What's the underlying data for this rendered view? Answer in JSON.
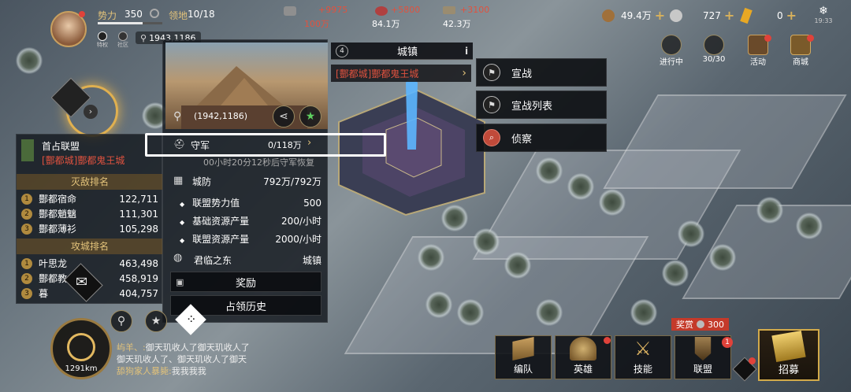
{
  "player": {
    "power_label": "势力",
    "power_value": "350",
    "territory_label": "领地",
    "territory_value": "10/18",
    "coords": "1943,1186",
    "tag_label": "特权",
    "community_label": "社区"
  },
  "production": [
    {
      "delta": "+9975",
      "total": "100万"
    },
    {
      "delta": "+5800",
      "total": "84.1万"
    },
    {
      "delta": "+3100",
      "total": "42.3万"
    }
  ],
  "currency": [
    {
      "value": "49.4万"
    },
    {
      "value": "727"
    },
    {
      "value": "0"
    }
  ],
  "clock": "19:33",
  "top_right_buttons": [
    {
      "label": "进行中"
    },
    {
      "label": "30/30"
    },
    {
      "label": "活动"
    },
    {
      "label": "商城"
    }
  ],
  "alliance_panel": {
    "title": "首占联盟",
    "city": "[酆都城]酆都鬼王城",
    "kill_rank_title": "灭敌排名",
    "kill_rank": [
      {
        "name": "酆都宿命",
        "value": "122,711"
      },
      {
        "name": "酆都魈魑",
        "value": "111,301"
      },
      {
        "name": "酆都薄衫",
        "value": "105,298"
      }
    ],
    "siege_rank_title": "攻城排名",
    "siege_rank": [
      {
        "name": "叶思龙",
        "value": "463,498"
      },
      {
        "name": "酆都教",
        "value": "458,919"
      },
      {
        "name": "暮",
        "value": "404,757"
      }
    ]
  },
  "city_info": {
    "coords": "(1942,1186)",
    "defense_label": "守军",
    "defense_value": "0/118万",
    "recover_text": "00小时20分12秒后守军恢复",
    "wall_label": "城防",
    "wall_value": "792万/792万",
    "power_label": "联盟势力值",
    "power_value": "500",
    "basic_res_label": "基础资源产量",
    "basic_res_value": "200/小时",
    "alliance_res_label": "联盟资源产量",
    "alliance_res_value": "2000/小时",
    "region_label": "君临之东",
    "region_value": "城镇",
    "reward_button": "奖励",
    "history_button": "占领历史"
  },
  "city_header": {
    "level": "4",
    "type": "城镇",
    "name": "[酆都城]酆都鬼王城"
  },
  "actions": [
    {
      "label": "宣战"
    },
    {
      "label": "宣战列表"
    },
    {
      "label": "侦察"
    }
  ],
  "compass": {
    "distance": "1291km"
  },
  "chat": {
    "line1_name": "屿羊、:",
    "line1_text": "御天玑收人了御天玑收人了",
    "line2_text": "御天玑收人了、御天玑收人了御天",
    "line3_name": "舔狗家人暴毙:",
    "line3_text": "我我我我"
  },
  "reward_badge": {
    "label": "奖赏",
    "value": "300"
  },
  "bottom_nav": [
    {
      "label": "编队"
    },
    {
      "label": "英雄"
    },
    {
      "label": "技能"
    },
    {
      "label": "联盟"
    },
    {
      "label": "招募"
    }
  ],
  "badge_alliance": "1",
  "colors": {
    "accent_gold": "#e2c27a",
    "alert_red": "#e0523f"
  }
}
